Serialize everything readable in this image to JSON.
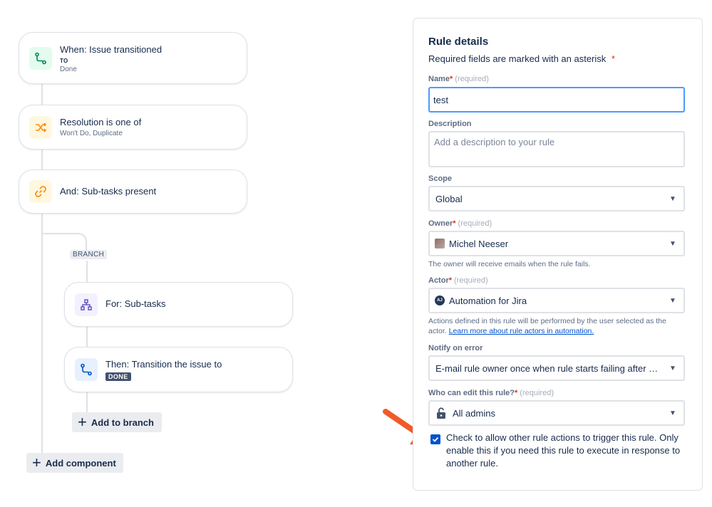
{
  "flow": {
    "trigger": {
      "title": "When: Issue transitioned",
      "to_label": "TO",
      "to_value": "Done"
    },
    "condition": {
      "title": "Resolution is one of",
      "values": "Won't Do, Duplicate"
    },
    "condition2": {
      "title": "And: Sub-tasks present"
    },
    "branch_label": "BRANCH",
    "branch_node": {
      "title": "For: Sub-tasks"
    },
    "action": {
      "title": "Then: Transition the issue to",
      "lozenge": "DONE"
    },
    "add_to_branch": "Add to branch",
    "add_component": "Add component"
  },
  "rule_details": {
    "heading": "Rule details",
    "required_note": "Required fields are marked with an asterisk",
    "asterisk": "*",
    "required_tag": "(required)",
    "name": {
      "label": "Name",
      "value": "test"
    },
    "description": {
      "label": "Description",
      "placeholder": "Add a description to your rule"
    },
    "scope": {
      "label": "Scope",
      "value": "Global"
    },
    "owner": {
      "label": "Owner",
      "value": "Michel Neeser",
      "help": "The owner will receive emails when the rule fails."
    },
    "actor": {
      "label": "Actor",
      "value": "Automation for Jira",
      "avatar": "AJ",
      "help": "Actions defined in this rule will be performed by the user selected as the actor.",
      "help_link": "Learn more about rule actors in automation."
    },
    "notify": {
      "label": "Notify on error",
      "value": "E-mail rule owner once when rule starts failing after success"
    },
    "who_can_edit": {
      "label": "Who can edit this rule?",
      "value": "All admins"
    },
    "checkbox": {
      "checked": true,
      "text": "Check to allow other rule actions to trigger this rule. Only enable this if you need this rule to execute in response to another rule."
    }
  },
  "colors": {
    "accent": "#0052cc",
    "annotation_arrow": "#f05a28",
    "trigger_icon_bg": "#e3fcef",
    "condition_icon_bg": "#fff7e0",
    "branch_icon_bg": "#f3f0ff",
    "action_icon_bg": "#e6f0ff"
  }
}
